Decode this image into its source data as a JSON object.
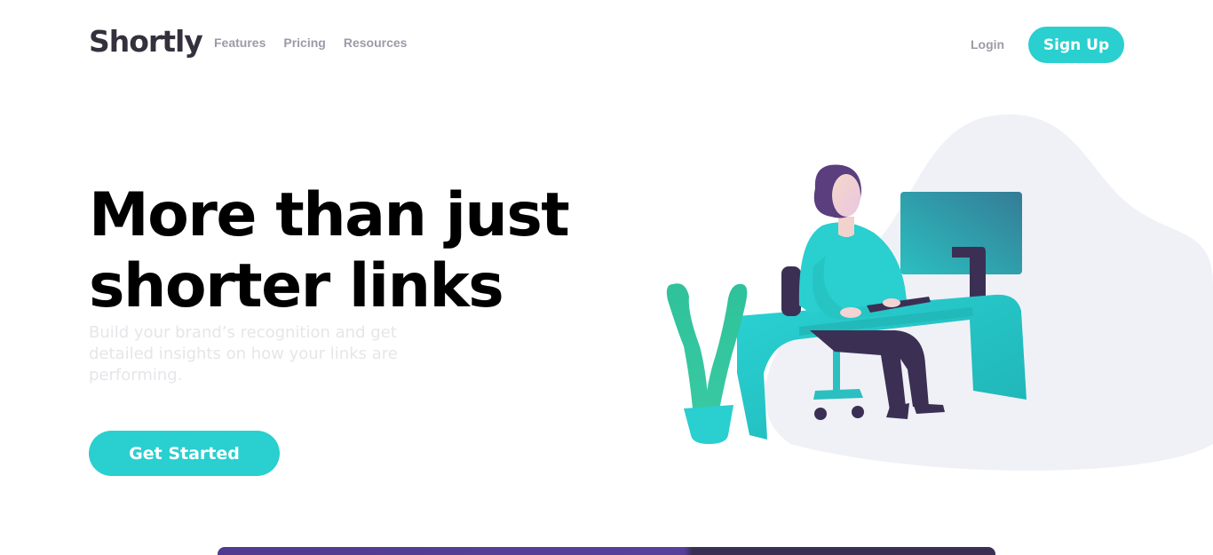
{
  "header": {
    "logo": "Shortly",
    "nav": [
      "Features",
      "Pricing",
      "Resources"
    ],
    "login_label": "Login",
    "signup_label": "Sign Up"
  },
  "hero": {
    "headline_line1": "More than just",
    "headline_line2": "shorter links",
    "subtext": "Build your brand’s recognition and get detailed insights on how your links are performing.",
    "cta_label": "Get Started",
    "illustration": "person-working-at-desk-illustration"
  },
  "colors": {
    "accent": "#2acfcf",
    "dark_violet": "#3b3054",
    "gray": "#9e9aa7",
    "blob": "#f0f1f6"
  }
}
